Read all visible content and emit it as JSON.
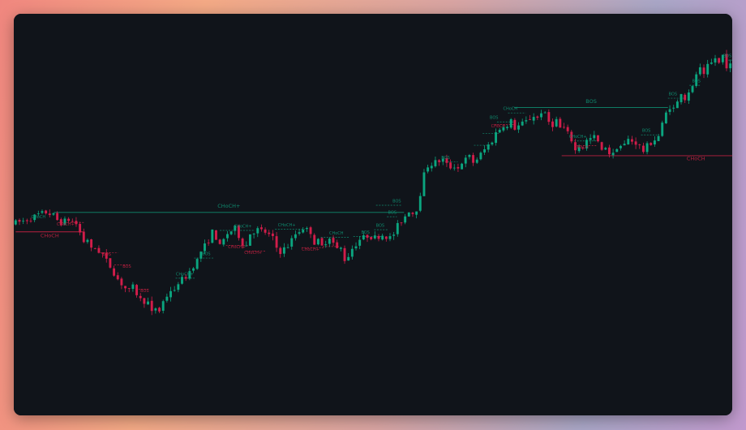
{
  "chart_data": {
    "type": "candlestick",
    "title": "",
    "colors": {
      "background": "#10141a",
      "bullish": "#0ba57f",
      "bearish": "#d11d4a",
      "bullish_structure": "#0f8a6e",
      "bearish_structure": "#b8203f"
    },
    "price_path": [
      [
        0,
        52.5
      ],
      [
        3,
        53.2
      ],
      [
        5,
        54.0
      ],
      [
        7,
        55.0
      ],
      [
        9,
        55.6
      ],
      [
        11,
        54.8
      ],
      [
        12,
        53.5
      ],
      [
        13,
        52.8
      ],
      [
        15,
        53.6
      ],
      [
        17,
        52.4
      ],
      [
        18,
        50.0
      ],
      [
        19,
        47.5
      ],
      [
        20,
        48.2
      ],
      [
        21,
        45.2
      ],
      [
        22,
        45.6
      ],
      [
        24,
        44.0
      ],
      [
        25,
        42.1
      ],
      [
        26,
        40.6
      ],
      [
        28,
        37.0
      ],
      [
        30,
        34.5
      ],
      [
        31,
        33.8
      ],
      [
        32,
        34.8
      ],
      [
        33,
        33.0
      ],
      [
        34,
        31.3
      ],
      [
        36,
        30.5
      ],
      [
        37,
        27.6
      ],
      [
        38,
        29.0
      ],
      [
        39,
        28.2
      ],
      [
        40,
        30.8
      ],
      [
        41,
        32.4
      ],
      [
        42,
        34.0
      ],
      [
        43,
        33.4
      ],
      [
        44,
        36.2
      ],
      [
        46,
        37.7
      ],
      [
        48,
        40.8
      ],
      [
        49,
        42.3
      ],
      [
        50,
        44.8
      ],
      [
        52,
        47.8
      ],
      [
        53,
        50.2
      ],
      [
        54,
        48.6
      ],
      [
        55,
        46.1
      ],
      [
        57,
        49.7
      ],
      [
        59,
        51.2
      ],
      [
        61,
        47.0
      ],
      [
        62,
        46.4
      ],
      [
        63,
        49.8
      ],
      [
        65,
        50.8
      ],
      [
        67,
        50.1
      ],
      [
        69,
        48.4
      ],
      [
        70,
        45.8
      ],
      [
        71,
        44.7
      ],
      [
        73,
        46.3
      ],
      [
        75,
        49.6
      ],
      [
        77,
        51.3
      ],
      [
        79,
        50.2
      ],
      [
        80,
        47.2
      ],
      [
        81,
        47.6
      ],
      [
        82,
        46.1
      ],
      [
        84,
        48.9
      ],
      [
        85,
        47.1
      ],
      [
        86,
        45.3
      ],
      [
        87,
        45.6
      ],
      [
        88,
        42.5
      ],
      [
        89,
        43.6
      ],
      [
        90,
        45.6
      ],
      [
        91,
        46.8
      ],
      [
        92,
        48.1
      ],
      [
        94,
        49.1
      ],
      [
        96,
        48.6
      ],
      [
        98,
        49.4
      ],
      [
        100,
        48.5
      ],
      [
        101,
        49.6
      ],
      [
        102,
        51.9
      ],
      [
        104,
        54.6
      ],
      [
        105,
        56.2
      ],
      [
        106,
        55.4
      ],
      [
        107,
        56.6
      ],
      [
        108,
        60.9
      ],
      [
        109,
        66.1
      ],
      [
        110,
        68.6
      ],
      [
        112,
        69.6
      ],
      [
        114,
        70.3
      ],
      [
        115,
        68.9
      ],
      [
        116,
        68.2
      ],
      [
        117,
        68.6
      ],
      [
        118,
        67.9
      ],
      [
        119,
        69.6
      ],
      [
        121,
        71.1
      ],
      [
        122,
        69.6
      ],
      [
        123,
        70.5
      ],
      [
        125,
        73.1
      ],
      [
        127,
        75.6
      ],
      [
        128,
        77.7
      ],
      [
        130,
        80.0
      ],
      [
        131,
        79.2
      ],
      [
        132,
        81.0
      ],
      [
        133,
        79.1
      ],
      [
        134,
        79.7
      ],
      [
        136,
        80.9
      ],
      [
        138,
        82.5
      ],
      [
        139,
        81.9
      ],
      [
        140,
        83.7
      ],
      [
        141,
        82.7
      ],
      [
        142,
        80.8
      ],
      [
        143,
        80.1
      ],
      [
        144,
        81.3
      ],
      [
        145,
        79.1
      ],
      [
        146,
        79.0
      ],
      [
        147,
        77.5
      ],
      [
        148,
        75.8
      ],
      [
        149,
        72.8
      ],
      [
        150,
        74.1
      ],
      [
        151,
        73.8
      ],
      [
        152,
        75.6
      ],
      [
        154,
        76.6
      ],
      [
        155,
        75.2
      ],
      [
        156,
        72.5
      ],
      [
        157,
        74.0
      ],
      [
        158,
        72.1
      ],
      [
        159,
        71.7
      ],
      [
        160,
        73.9
      ],
      [
        162,
        74.4
      ],
      [
        163,
        75.9
      ],
      [
        165,
        75.0
      ],
      [
        166,
        74.0
      ],
      [
        167,
        72.7
      ],
      [
        168,
        74.1
      ],
      [
        170,
        75.9
      ],
      [
        171,
        76.9
      ],
      [
        172,
        80.1
      ],
      [
        173,
        83.2
      ],
      [
        174,
        85.1
      ],
      [
        175,
        84.5
      ],
      [
        176,
        86.2
      ],
      [
        177,
        89.2
      ],
      [
        178,
        87.3
      ],
      [
        179,
        89.4
      ],
      [
        180,
        90.2
      ],
      [
        181,
        94.2
      ],
      [
        182,
        95.4
      ],
      [
        183,
        93.4
      ],
      [
        184,
        96.2
      ],
      [
        185,
        97.1
      ],
      [
        186,
        98.6
      ],
      [
        187,
        97.1
      ],
      [
        188,
        99.4
      ],
      [
        189,
        96.5
      ]
    ],
    "structure_lines": [
      {
        "type": "bullish",
        "style": "solid",
        "x1": 10.1,
        "x2": 102.7,
        "y": 55.6
      },
      {
        "type": "bearish",
        "style": "solid",
        "x1": 0,
        "x2": 17.8,
        "y": 50.2
      },
      {
        "type": "bullish",
        "style": "solid",
        "x1": 131.8,
        "x2": 172.5,
        "y": 84.8
      },
      {
        "type": "bearish",
        "style": "solid",
        "x1": 144.4,
        "x2": 189.5,
        "y": 71.4
      },
      {
        "type": "bearish",
        "style": "dashed",
        "x1": 11.4,
        "x2": 18.1,
        "y": 52.8
      },
      {
        "type": "bearish",
        "style": "dashed",
        "x1": 22.4,
        "x2": 27.1,
        "y": 44.4
      },
      {
        "type": "bearish",
        "style": "dashed",
        "x1": 26.1,
        "x2": 30.2,
        "y": 41.0
      },
      {
        "type": "bearish",
        "style": "dashed",
        "x1": 31.7,
        "x2": 35.2,
        "y": 34.2
      },
      {
        "type": "bullish",
        "style": "dashed",
        "x1": 42.3,
        "x2": 47.3,
        "y": 37.3
      },
      {
        "type": "bullish",
        "style": "dashed",
        "x1": 47.2,
        "x2": 52.6,
        "y": 42.9
      },
      {
        "type": "bullish",
        "style": "dashed",
        "x1": 54.0,
        "x2": 63.3,
        "y": 50.6
      },
      {
        "type": "bearish",
        "style": "dashed",
        "x1": 55.6,
        "x2": 61.7,
        "y": 46.4
      },
      {
        "type": "bearish",
        "style": "dashed",
        "x1": 60.9,
        "x2": 66.2,
        "y": 44.8
      },
      {
        "type": "bullish",
        "style": "dashed",
        "x1": 68.6,
        "x2": 76.5,
        "y": 50.9
      },
      {
        "type": "bearish",
        "style": "dashed",
        "x1": 75.6,
        "x2": 81.6,
        "y": 45.8
      },
      {
        "type": "bearish",
        "style": "dashed",
        "x1": 81.2,
        "x2": 85.9,
        "y": 46.1
      },
      {
        "type": "bullish",
        "style": "dashed",
        "x1": 80.7,
        "x2": 88.1,
        "y": 48.7
      },
      {
        "type": "bullish",
        "style": "dashed",
        "x1": 89.3,
        "x2": 96.7,
        "y": 48.9
      },
      {
        "type": "bullish",
        "style": "dashed",
        "x1": 94.8,
        "x2": 98.6,
        "y": 50.8
      },
      {
        "type": "bullish",
        "style": "dashed",
        "x1": 98.2,
        "x2": 100.8,
        "y": 54.4
      },
      {
        "type": "bullish",
        "style": "dashed",
        "x1": 95.3,
        "x2": 102.2,
        "y": 57.6
      },
      {
        "type": "bullish",
        "style": "dashed",
        "x1": 112.0,
        "x2": 116.9,
        "y": 69.7
      },
      {
        "type": "bullish",
        "style": "dashed",
        "x1": 121.2,
        "x2": 126.3,
        "y": 74.3
      },
      {
        "type": "bullish",
        "style": "dashed",
        "x1": 123.5,
        "x2": 128.0,
        "y": 77.6
      },
      {
        "type": "bullish",
        "style": "dashed",
        "x1": 127.3,
        "x2": 131.6,
        "y": 80.8
      },
      {
        "type": "bullish",
        "style": "dashed",
        "x1": 130.2,
        "x2": 134.9,
        "y": 83.3
      },
      {
        "type": "bearish",
        "style": "dashed",
        "x1": 126.6,
        "x2": 132.0,
        "y": 80.1
      },
      {
        "type": "bearish",
        "style": "dashed",
        "x1": 147.7,
        "x2": 153.7,
        "y": 74.2
      },
      {
        "type": "bullish",
        "style": "dashed",
        "x1": 147.7,
        "x2": 153.7,
        "y": 75.5
      },
      {
        "type": "bullish",
        "style": "dashed",
        "x1": 165.4,
        "x2": 169.6,
        "y": 77.2
      },
      {
        "type": "bullish",
        "style": "dashed",
        "x1": 172.5,
        "x2": 176.8,
        "y": 87.4
      },
      {
        "type": "bullish",
        "style": "dashed",
        "x1": 178.2,
        "x2": 181.2,
        "y": 91.0
      },
      {
        "type": "bullish",
        "style": "dashed",
        "x1": 186.9,
        "x2": 189.5,
        "y": 98.0
      }
    ],
    "labels": [
      {
        "text": "CHoCH+",
        "type": "bullish",
        "x": 56.4,
        "y": 56.9,
        "size": "big"
      },
      {
        "text": "CHoCH",
        "type": "bearish",
        "x": 9.0,
        "y": 48.7,
        "size": "big"
      },
      {
        "text": "BOS",
        "type": "bullish",
        "x": 152.2,
        "y": 86.1,
        "size": "big"
      },
      {
        "text": "CHoCH",
        "type": "bearish",
        "x": 179.9,
        "y": 70.1,
        "size": "big"
      },
      {
        "text": "CHoCH",
        "type": "bullish",
        "x": 6.0,
        "y": 54.0
      },
      {
        "text": "CHoCH+",
        "type": "bearish",
        "x": 13.2,
        "y": 52.0
      },
      {
        "text": "BOS",
        "type": "bearish",
        "x": 24.1,
        "y": 43.6
      },
      {
        "text": "BOS",
        "type": "bearish",
        "x": 29.4,
        "y": 40.2
      },
      {
        "text": "BOS",
        "type": "bearish",
        "x": 34.1,
        "y": 33.4
      },
      {
        "text": "CHoCH+",
        "type": "bullish",
        "x": 44.7,
        "y": 38.1
      },
      {
        "text": "BOS",
        "type": "bullish",
        "x": 50.4,
        "y": 43.7
      },
      {
        "text": "CHoCH+",
        "type": "bullish",
        "x": 60.1,
        "y": 51.4
      },
      {
        "text": "CHoCH+",
        "type": "bearish",
        "x": 58.5,
        "y": 45.6
      },
      {
        "text": "CHoCH+",
        "type": "bearish",
        "x": 62.8,
        "y": 44.0
      },
      {
        "text": "CHoCH+",
        "type": "bullish",
        "x": 71.7,
        "y": 51.7
      },
      {
        "text": "CHoCH+",
        "type": "bearish",
        "x": 78.0,
        "y": 45.0
      },
      {
        "text": "CHoCH",
        "type": "bullish",
        "x": 84.8,
        "y": 49.5
      },
      {
        "text": "BOS",
        "type": "bullish",
        "x": 92.5,
        "y": 49.7
      },
      {
        "text": "BOS",
        "type": "bullish",
        "x": 96.4,
        "y": 51.6
      },
      {
        "text": "BOS",
        "type": "bullish",
        "x": 99.6,
        "y": 55.2
      },
      {
        "text": "BOS",
        "type": "bullish",
        "x": 100.8,
        "y": 58.4
      },
      {
        "text": "BOS",
        "type": "bullish",
        "x": 113.7,
        "y": 70.5
      },
      {
        "text": "BOS",
        "type": "bullish",
        "x": 126.5,
        "y": 81.6
      },
      {
        "text": "CHoCH",
        "type": "bullish",
        "x": 130.8,
        "y": 84.1
      },
      {
        "text": "CHoCH",
        "type": "bearish",
        "x": 127.6,
        "y": 79.3
      },
      {
        "text": "CHoCH+",
        "type": "bullish",
        "x": 148.7,
        "y": 76.3
      },
      {
        "text": "CHoCH",
        "type": "bearish",
        "x": 149.6,
        "y": 73.4
      },
      {
        "text": "BOS",
        "type": "bullish",
        "x": 166.8,
        "y": 78.0
      },
      {
        "text": "BOS",
        "type": "bullish",
        "x": 173.8,
        "y": 88.2
      },
      {
        "text": "BOS",
        "type": "bullish",
        "x": 180.0,
        "y": 91.8
      },
      {
        "text": "BOS",
        "type": "bullish",
        "x": 188.2,
        "y": 98.8
      }
    ]
  }
}
